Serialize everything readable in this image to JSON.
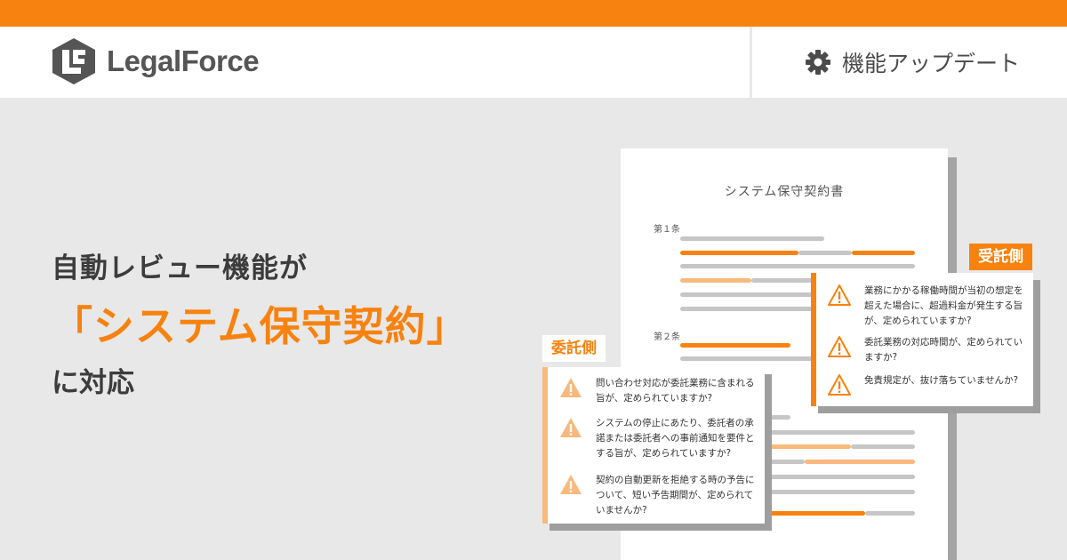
{
  "brand": {
    "name": "LegalForce",
    "accent": "#f7820f",
    "accent_light": "#f8b97c"
  },
  "header": {
    "feature_icon": "gear-icon",
    "feature_label": "機能アップデート"
  },
  "headline": {
    "line1": "自動レビュー機能が",
    "line2": "「システム保守契約」",
    "line3": "に対応"
  },
  "document": {
    "title": "システム保守契約書",
    "clause1": "第１条",
    "clause2": "第２条"
  },
  "vendor": {
    "tag": "受託側",
    "items": [
      "業務にかかる稼働時間が当初の想定を超えた場合に、超過料金が発生する旨が、定められていますか?",
      "委託業務の対応時間が、定められていますか?",
      "免責規定が、抜け落ちていませんか?"
    ]
  },
  "client": {
    "tag": "委託側",
    "items": [
      "問い合わせ対応が委託業務に含まれる旨が、定められていますか?",
      "システムの停止にあたり、委託者の承諾または委託者への事前通知を要件とする旨が、定められていますか?",
      "契約の自動更新を拒絶する時の予告について、短い予告期間が、定められていませんか?"
    ]
  }
}
